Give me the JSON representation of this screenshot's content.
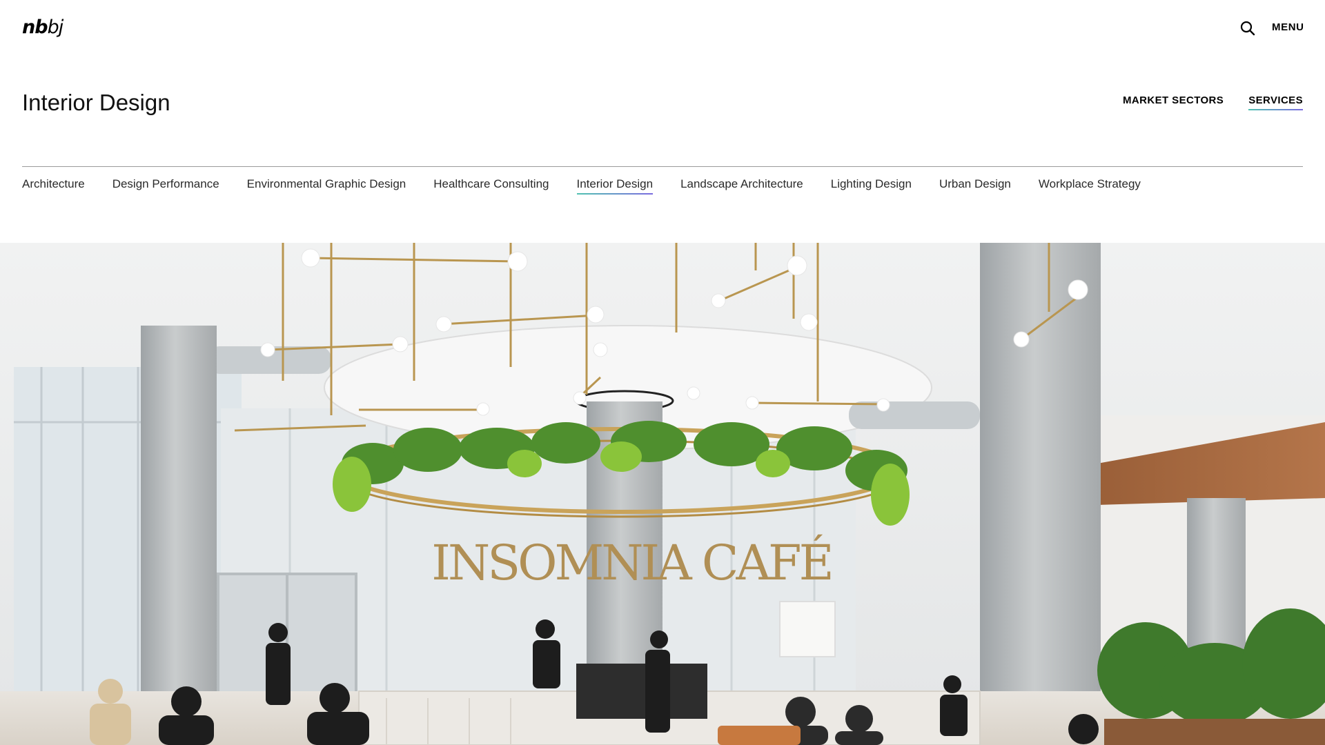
{
  "header": {
    "logo_bold": "nb",
    "logo_light": "bj",
    "menu_label": "MENU",
    "search_icon": "search-icon"
  },
  "page": {
    "title": "Interior Design"
  },
  "top_nav": {
    "items": [
      {
        "label": "MARKET SECTORS",
        "active": false
      },
      {
        "label": "SERVICES",
        "active": true
      }
    ]
  },
  "sub_nav": {
    "items": [
      {
        "label": "Architecture",
        "active": false
      },
      {
        "label": "Design Performance",
        "active": false
      },
      {
        "label": "Environmental Graphic Design",
        "active": false
      },
      {
        "label": "Healthcare Consulting",
        "active": false
      },
      {
        "label": "Interior Design",
        "active": true
      },
      {
        "label": "Landscape Architecture",
        "active": false
      },
      {
        "label": "Lighting Design",
        "active": false
      },
      {
        "label": "Urban Design",
        "active": false
      },
      {
        "label": "Workplace Strategy",
        "active": false
      }
    ]
  },
  "hero": {
    "signage": "INSOMNIA CAFÉ"
  },
  "colors": {
    "accent_start": "#4fc2b0",
    "accent_end": "#7b6ae0",
    "text": "#1a1a1a",
    "background": "#ffffff"
  }
}
